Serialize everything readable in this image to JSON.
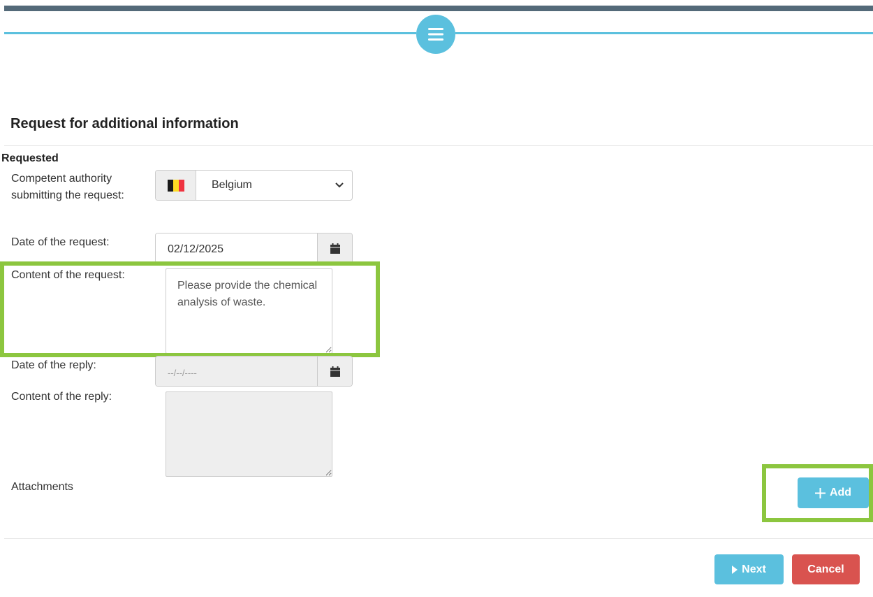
{
  "header": {
    "menu_icon": "hamburger-icon",
    "accent_color": "#5bc0de",
    "bar_color": "#546a79"
  },
  "section": {
    "title": "Request for additional information",
    "subsection": "Requested"
  },
  "form": {
    "authority": {
      "label": "Competent authority submitting the request:",
      "flag_icon": "belgium-flag-icon",
      "value": "Belgium"
    },
    "request_date": {
      "label": "Date of the request:",
      "value": "02/12/2025",
      "icon": "calendar-icon"
    },
    "request_content": {
      "label": "Content of the request:",
      "value": "Please provide the chemical analysis of waste."
    },
    "reply_date": {
      "label": "Date of the reply:",
      "placeholder": "--/--/----",
      "icon": "calendar-icon"
    },
    "reply_content": {
      "label": "Content of the reply:",
      "value": ""
    },
    "attachments": {
      "label": "Attachments",
      "add_label": "Add"
    }
  },
  "footer": {
    "next_label": "Next",
    "cancel_label": "Cancel"
  },
  "colors": {
    "highlight": "#8cc63f",
    "danger": "#d9534f",
    "info": "#5bc0de"
  }
}
